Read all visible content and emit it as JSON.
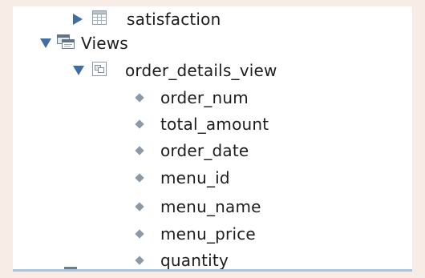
{
  "tree": {
    "table_item": {
      "label": "satisfaction",
      "icon": "table-icon"
    },
    "views_group": {
      "label": "Views",
      "icon": "views-folder-icon"
    },
    "view_item": {
      "label": "order_details_view",
      "icon": "view-icon"
    },
    "columns": [
      {
        "label": "order_num",
        "icon": "column-diamond-icon"
      },
      {
        "label": "total_amount",
        "icon": "column-diamond-icon"
      },
      {
        "label": "order_date",
        "icon": "column-diamond-icon"
      },
      {
        "label": "menu_id",
        "icon": "column-diamond-icon"
      },
      {
        "label": "menu_name",
        "icon": "column-diamond-icon"
      },
      {
        "label": "menu_price",
        "icon": "column-diamond-icon"
      },
      {
        "label": "quantity",
        "icon": "column-diamond-icon"
      }
    ]
  },
  "colors": {
    "expander": "#3f6ea3",
    "background": "#f7ece6",
    "panel": "#ffffff",
    "text": "#1d1d1d",
    "column_marker": "#8a9aa8",
    "selection_line": "#a7c4de"
  }
}
